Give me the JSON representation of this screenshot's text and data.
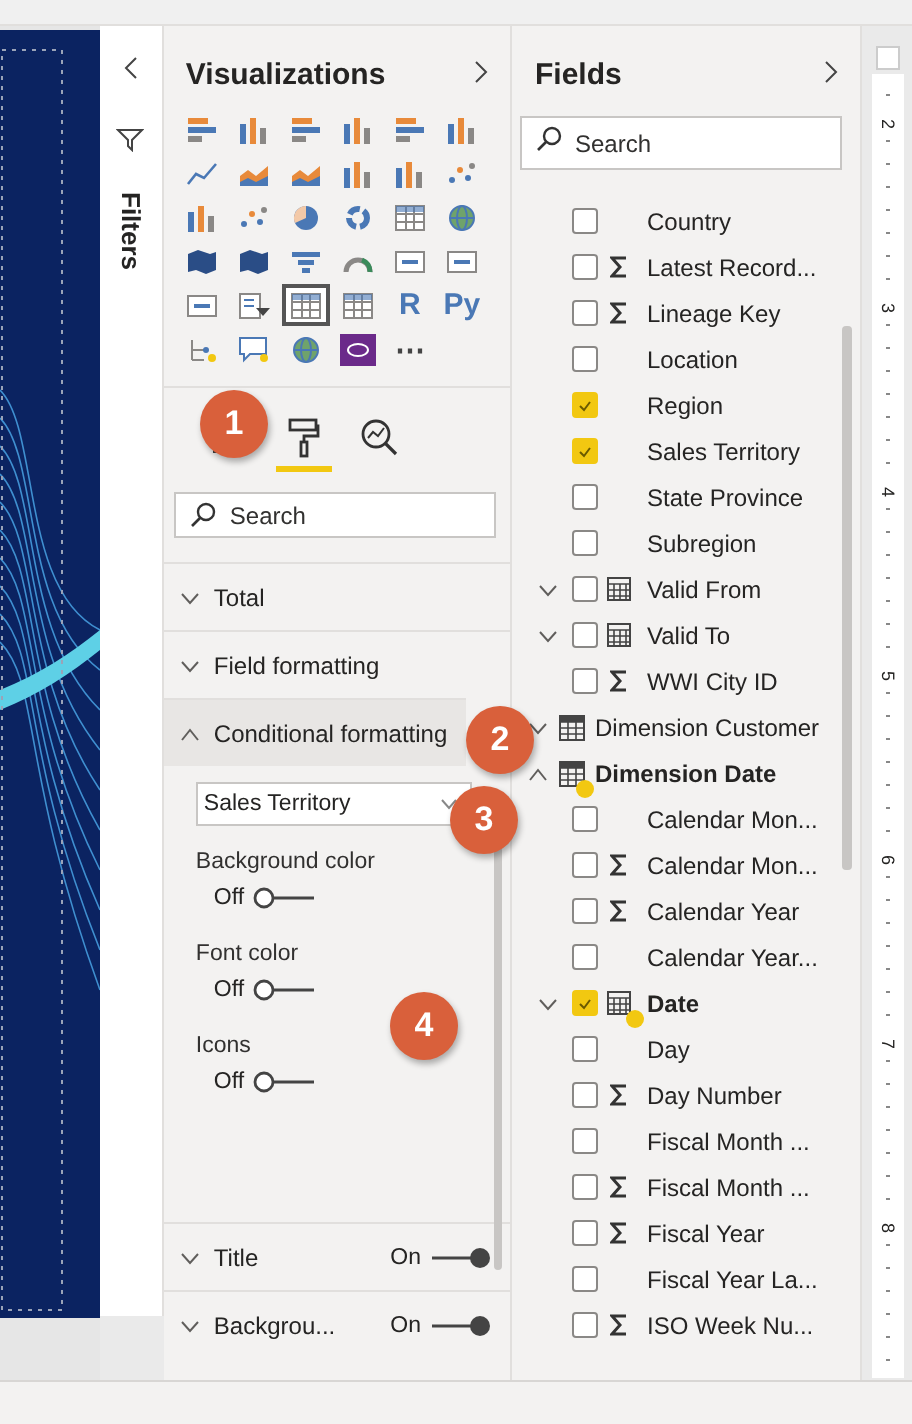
{
  "filters": {
    "title": "Filters"
  },
  "visualizations": {
    "title": "Visualizations",
    "visuals": [
      {
        "kind": "hbar",
        "selected": false
      },
      {
        "kind": "vbar",
        "selected": false
      },
      {
        "kind": "hbar",
        "selected": false
      },
      {
        "kind": "vbar",
        "selected": false
      },
      {
        "kind": "hbar",
        "selected": false
      },
      {
        "kind": "vbar",
        "selected": false
      },
      {
        "kind": "line",
        "selected": false
      },
      {
        "kind": "area",
        "selected": false
      },
      {
        "kind": "area",
        "selected": false
      },
      {
        "kind": "vbar",
        "selected": false
      },
      {
        "kind": "vbar",
        "selected": false
      },
      {
        "kind": "scatter",
        "selected": false
      },
      {
        "kind": "vbar",
        "selected": false
      },
      {
        "kind": "scatter",
        "selected": false
      },
      {
        "kind": "pie",
        "selected": false
      },
      {
        "kind": "donut",
        "selected": false
      },
      {
        "kind": "grid",
        "selected": false
      },
      {
        "kind": "globe",
        "selected": false
      },
      {
        "kind": "map",
        "selected": false
      },
      {
        "kind": "map",
        "selected": false
      },
      {
        "kind": "funnel",
        "selected": false
      },
      {
        "kind": "gauge",
        "selected": false
      },
      {
        "kind": "card",
        "selected": false
      },
      {
        "kind": "card",
        "selected": false
      },
      {
        "kind": "card",
        "selected": false
      },
      {
        "kind": "slicer",
        "selected": false
      },
      {
        "kind": "grid",
        "selected": true
      },
      {
        "kind": "grid",
        "selected": false
      },
      {
        "kind": "script",
        "label": "R",
        "selected": false
      },
      {
        "kind": "script",
        "label": "Py",
        "selected": false
      },
      {
        "kind": "tree",
        "selected": false
      },
      {
        "kind": "chat",
        "selected": false
      },
      {
        "kind": "globe",
        "selected": false
      },
      {
        "kind": "custom",
        "selected": false
      },
      {
        "kind": "more",
        "label": "⋯",
        "selected": false
      }
    ],
    "tabs": [
      {
        "kind": "fields",
        "selected": false
      },
      {
        "kind": "format",
        "selected": true
      },
      {
        "kind": "analytics",
        "selected": false
      }
    ],
    "search": {
      "placeholder": "Search"
    },
    "sections": [
      {
        "label": "Total",
        "expanded": false
      },
      {
        "label": "Field formatting",
        "expanded": false
      },
      {
        "label": "Conditional formatting",
        "expanded": true,
        "field": "Sales Territory",
        "options": [
          {
            "label": "Background color",
            "state": "Off",
            "on": false
          },
          {
            "label": "Font color",
            "state": "Off",
            "on": false
          },
          {
            "label": "Icons",
            "state": "Off",
            "on": false
          }
        ]
      },
      {
        "label": "Title",
        "expanded": false,
        "toggle": {
          "state": "On",
          "on": true
        }
      },
      {
        "label": "Backgrou...",
        "expanded": false,
        "toggle": {
          "state": "On",
          "on": true
        }
      }
    ]
  },
  "fields": {
    "title": "Fields",
    "search": {
      "placeholder": "Search"
    },
    "tree": [
      {
        "kind": "partial",
        "children": [
          {
            "name": "Country",
            "kind": "text",
            "checked": false
          },
          {
            "name": "Latest Record...",
            "kind": "sum",
            "checked": false
          },
          {
            "name": "Lineage Key",
            "kind": "sum",
            "checked": false
          },
          {
            "name": "Location",
            "kind": "text",
            "checked": false
          },
          {
            "name": "Region",
            "kind": "text",
            "checked": true
          },
          {
            "name": "Sales Territory",
            "kind": "text",
            "checked": true
          },
          {
            "name": "State Province",
            "kind": "text",
            "checked": false
          },
          {
            "name": "Subregion",
            "kind": "text",
            "checked": false
          },
          {
            "name": "Valid From",
            "kind": "date",
            "checked": false,
            "in_use": false,
            "expanded": false
          },
          {
            "name": "Valid To",
            "kind": "date",
            "checked": false,
            "in_use": false,
            "expanded": false
          },
          {
            "name": "WWI City ID",
            "kind": "sum",
            "checked": false
          }
        ]
      },
      {
        "kind": "table",
        "name": "Dimension Customer",
        "expanded": false,
        "in_use": false
      },
      {
        "kind": "table",
        "name": "Dimension Date",
        "expanded": true,
        "in_use": true,
        "children": [
          {
            "name": "Calendar Mon...",
            "kind": "text",
            "checked": false
          },
          {
            "name": "Calendar Mon...",
            "kind": "sum",
            "checked": false
          },
          {
            "name": "Calendar Year",
            "kind": "sum",
            "checked": false
          },
          {
            "name": "Calendar Year...",
            "kind": "text",
            "checked": false
          },
          {
            "name": "Date",
            "kind": "date",
            "checked": true,
            "in_use": true,
            "expanded": false
          },
          {
            "name": "Day",
            "kind": "text",
            "checked": false
          },
          {
            "name": "Day Number",
            "kind": "sum",
            "checked": false
          },
          {
            "name": "Fiscal Month ...",
            "kind": "text",
            "checked": false
          },
          {
            "name": "Fiscal Month ...",
            "kind": "sum",
            "checked": false
          },
          {
            "name": "Fiscal Year",
            "kind": "sum",
            "checked": false
          },
          {
            "name": "Fiscal Year La...",
            "kind": "text",
            "checked": false
          },
          {
            "name": "ISO Week Nu...",
            "kind": "sum",
            "checked": false
          }
        ]
      }
    ]
  },
  "ruler": {
    "labels": [
      "2",
      "3",
      "4",
      "5",
      "6",
      "7",
      "8"
    ]
  },
  "callouts": [
    {
      "text": "1"
    },
    {
      "text": "2"
    },
    {
      "text": "3"
    },
    {
      "text": "4"
    }
  ]
}
